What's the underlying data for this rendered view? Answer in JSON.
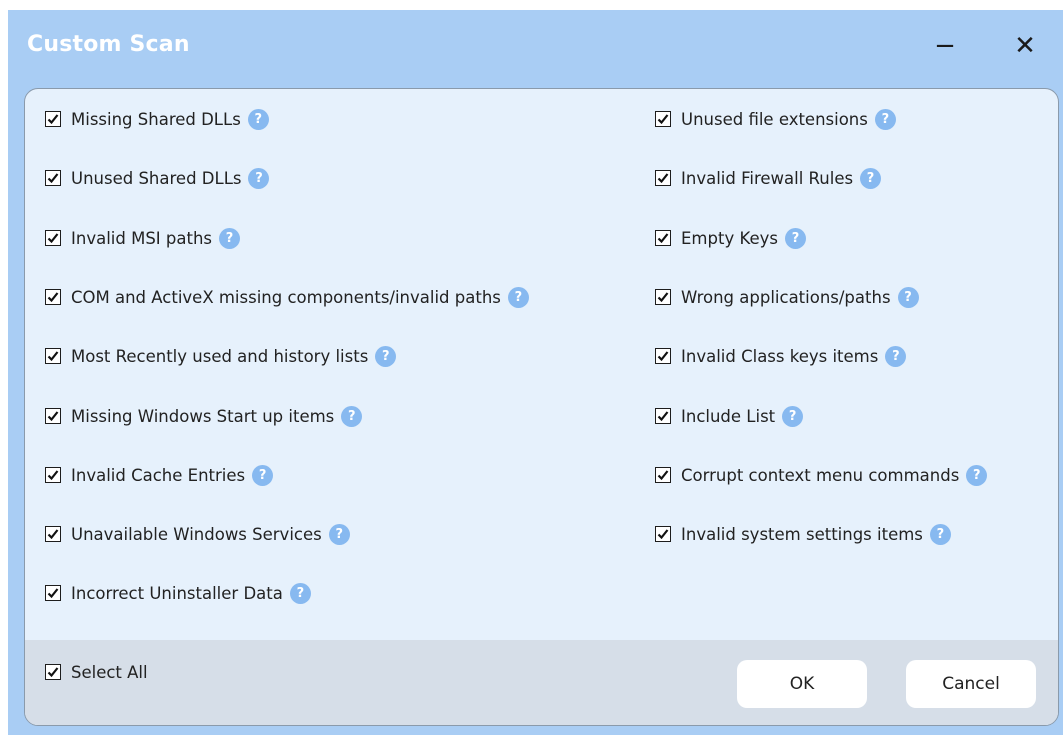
{
  "window": {
    "title": "Custom Scan",
    "minimize_glyph": "−",
    "close_glyph": "✕"
  },
  "help_glyph": "?",
  "left_items": [
    {
      "label": "Missing Shared DLLs",
      "checked": true
    },
    {
      "label": "Unused Shared DLLs",
      "checked": true
    },
    {
      "label": "Invalid MSI paths",
      "checked": true
    },
    {
      "label": "COM and ActiveX missing components/invalid paths",
      "checked": true
    },
    {
      "label": "Most Recently used and history lists",
      "checked": true
    },
    {
      "label": "Missing Windows Start up items",
      "checked": true
    },
    {
      "label": "Invalid Cache Entries",
      "checked": true
    },
    {
      "label": "Unavailable Windows Services",
      "checked": true
    },
    {
      "label": "Incorrect Uninstaller Data",
      "checked": true
    }
  ],
  "right_items": [
    {
      "label": "Unused file extensions",
      "checked": true
    },
    {
      "label": "Invalid Firewall Rules",
      "checked": true
    },
    {
      "label": "Empty Keys",
      "checked": true
    },
    {
      "label": "Wrong applications/paths",
      "checked": true
    },
    {
      "label": "Invalid Class keys items",
      "checked": true
    },
    {
      "label": "Include List",
      "checked": true
    },
    {
      "label": "Corrupt context menu commands",
      "checked": true
    },
    {
      "label": "Invalid system settings items",
      "checked": true
    }
  ],
  "footer": {
    "select_all_label": "Select All",
    "select_all_checked": true,
    "ok_label": "OK",
    "cancel_label": "Cancel"
  },
  "colors": {
    "titlebar": "#a9cdf4",
    "panel": "#e6f1fc",
    "footer": "#d6dee8",
    "help_badge": "#87b9f0"
  }
}
